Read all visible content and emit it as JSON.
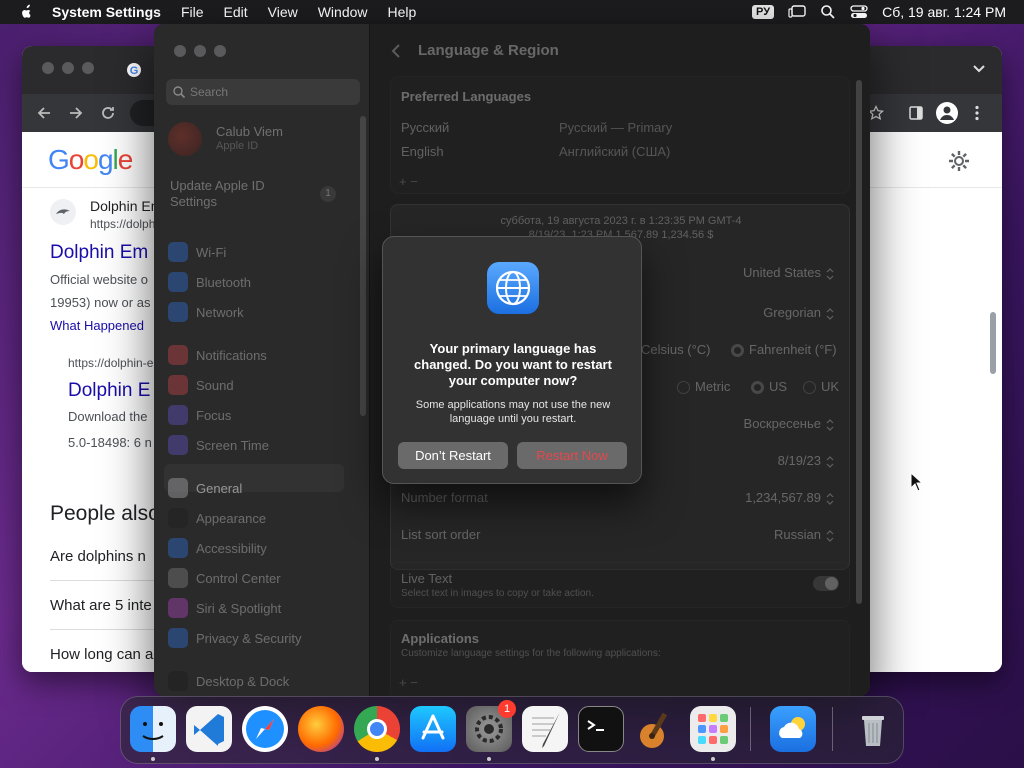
{
  "menubar": {
    "app_name": "System Settings",
    "menus": [
      "File",
      "Edit",
      "View",
      "Window",
      "Help"
    ],
    "input_source": "РУ",
    "datetime": "Сб, 19 авг.  1:24 PM"
  },
  "chrome": {
    "google_logo": "Google",
    "results": [
      {
        "site": "Dolphin Em",
        "url": "https://dolph",
        "title": "Dolphin Em",
        "snippet1": "Official website o",
        "snippet2": "19953) now or as",
        "link": "What Happened"
      },
      {
        "url": "https://dolphin-e",
        "title": "Dolphin E",
        "snippet1": "Download the",
        "snippet2": "5.0-18498: 6 n"
      }
    ],
    "people_also": "People also",
    "questions": [
      "Are dolphins n",
      "What are 5 inte",
      "How long can a"
    ]
  },
  "settings": {
    "search_placeholder": "Search",
    "account_name": "Calub Viem",
    "account_sub": "Apple ID",
    "update_label": "Update Apple ID Settings",
    "update_badge": "1",
    "sidebar": [
      {
        "label": "Wi-Fi",
        "color": "#2f7cf6",
        "icon": "wifi-icon"
      },
      {
        "label": "Bluetooth",
        "color": "#2f7cf6",
        "icon": "bluetooth-icon"
      },
      {
        "label": "Network",
        "color": "#2f7cf6",
        "icon": "globe-icon"
      },
      {
        "label": "Notifications",
        "color": "#e5484d",
        "icon": "bell-icon"
      },
      {
        "label": "Sound",
        "color": "#e5484d",
        "icon": "speaker-icon"
      },
      {
        "label": "Focus",
        "color": "#6e5ce6",
        "icon": "moon-icon"
      },
      {
        "label": "Screen Time",
        "color": "#6e5ce6",
        "icon": "hourglass-icon"
      },
      {
        "label": "General",
        "color": "#8e8e93",
        "icon": "gear-icon"
      },
      {
        "label": "Appearance",
        "color": "#1c1c1e",
        "icon": "appearance-icon"
      },
      {
        "label": "Accessibility",
        "color": "#2f7cf6",
        "icon": "accessibility-icon"
      },
      {
        "label": "Control Center",
        "color": "#8e8e93",
        "icon": "control-center-icon"
      },
      {
        "label": "Siri & Spotlight",
        "color": "#c74bd9",
        "icon": "siri-icon"
      },
      {
        "label": "Privacy & Security",
        "color": "#2f7cf6",
        "icon": "hand-icon"
      },
      {
        "label": "Desktop & Dock",
        "color": "#1c1c1e",
        "icon": "dock-icon"
      }
    ],
    "page_title": "Language & Region",
    "preferred_title": "Preferred Languages",
    "languages": [
      {
        "name": "Русский",
        "desc": "Русский — Primary"
      },
      {
        "name": "English",
        "desc": "Английский (США)"
      }
    ],
    "add_remove": "+  −",
    "preview_line1": "суббота, 19 августа 2023 г. в 1:23:35 PM GMT-4",
    "preview_line2": "8/19/23, 1:23 PM      1,567.89      1,234.56 $",
    "region": "United States",
    "calendar": "Gregorian",
    "temp_c": "Celsius (°C)",
    "temp_f": "Fahrenheit (°F)",
    "measure_metric": "Metric",
    "measure_us": "US",
    "measure_uk": "UK",
    "first_day": "Воскресенье",
    "date_format": "8/19/23",
    "number_format_label": "Number format",
    "number_format": "1,234,567.89",
    "sort_label": "List sort order",
    "sort_value": "Russian",
    "live_text_title": "Live Text",
    "live_text_sub": "Select text in images to copy or take action.",
    "apps_title": "Applications",
    "apps_sub": "Customize language settings for the following applications:"
  },
  "modal": {
    "title": "Your primary language has changed. Do you want to restart your computer now?",
    "message": "Some applications may not use the new language until you restart.",
    "dont_restart": "Don’t Restart",
    "restart_now": "Restart Now"
  },
  "dock": {
    "apps": [
      "Finder",
      "Visual Studio Code",
      "Safari",
      "Firefox",
      "Google Chrome",
      "App Store",
      "System Settings",
      "TextEdit",
      "Terminal",
      "GarageBand",
      "Launchpad",
      "Weather",
      "Trash"
    ],
    "settings_badge": "1"
  },
  "colors": {
    "accent": "#2f7cf6",
    "danger": "#e5484d",
    "google_link": "#1a0dab"
  }
}
